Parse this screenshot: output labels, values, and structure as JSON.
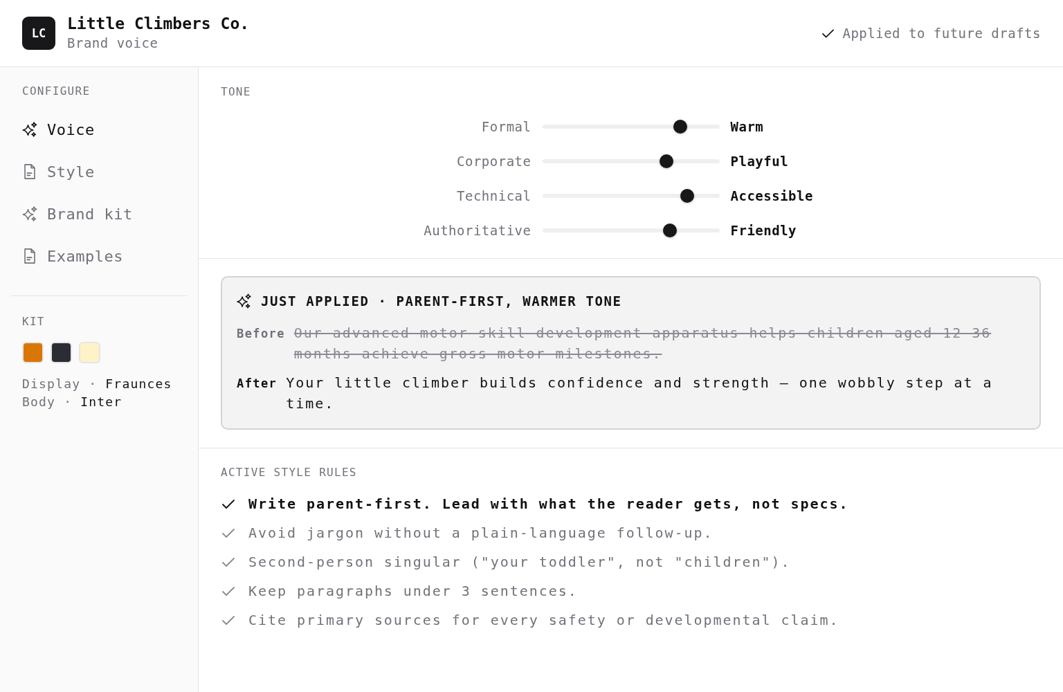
{
  "header": {
    "logo": {
      "initials": "LC"
    },
    "title": "Little Climbers Co.",
    "subtitle": "Brand voice",
    "status": "Applied to future drafts"
  },
  "sidebar": {
    "heading": "CONFIGURE",
    "items": [
      {
        "label": "Voice",
        "kind": "sparkles",
        "selected": true
      },
      {
        "label": "Style",
        "kind": "document",
        "selected": false
      },
      {
        "label": "Brand kit",
        "kind": "sparkles",
        "selected": false
      },
      {
        "label": "Examples",
        "kind": "document",
        "selected": false
      }
    ],
    "kit": {
      "heading": "KIT",
      "swatches": [
        {
          "color": "#d97706"
        },
        {
          "color": "#2a2d34"
        },
        {
          "color": "#fef3c7"
        }
      ],
      "fonts": [
        {
          "role": "Display",
          "separator": "·",
          "name": "Fraunces"
        },
        {
          "role": "Body",
          "separator": "·",
          "name": "Inter"
        }
      ]
    }
  },
  "tone": {
    "heading": "TONE",
    "sliders": [
      {
        "left": "Formal",
        "right": "Warm",
        "level": 0.78
      },
      {
        "left": "Corporate",
        "right": "Playful",
        "level": 0.7
      },
      {
        "left": "Technical",
        "right": "Accessible",
        "level": 0.82
      },
      {
        "left": "Authoritative",
        "right": "Friendly",
        "level": 0.72
      }
    ]
  },
  "just_applied": {
    "title": "JUST APPLIED · PARENT-FIRST, WARMER TONE",
    "before_label": "Before",
    "before": "Our advanced motor-skill development apparatus helps children aged 12-36 months achieve gross-motor milestones.",
    "after_label": "After",
    "after": "Your little climber builds confidence and strength — one wobbly step at a time."
  },
  "style_rules": {
    "heading": "ACTIVE STYLE RULES",
    "rules": [
      {
        "text": "Write parent-first. Lead with what the reader gets, not specs.",
        "highlighted": true
      },
      {
        "text": "Avoid jargon without a plain-language follow-up.",
        "highlighted": false
      },
      {
        "text": "Second-person singular (\"your toddler\", not \"children\").",
        "highlighted": false
      },
      {
        "text": "Keep paragraphs under 3 sentences.",
        "highlighted": false
      },
      {
        "text": "Cite primary sources for every safety or developmental claim.",
        "highlighted": false
      }
    ]
  }
}
